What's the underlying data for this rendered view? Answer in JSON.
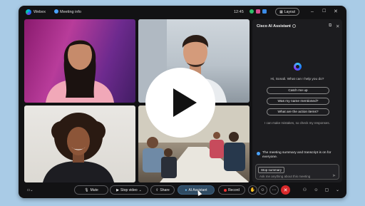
{
  "app": {
    "name": "Webex",
    "meeting_info_label": "Meeting info",
    "time": "12:45",
    "layout_label": "Layout"
  },
  "ai_panel": {
    "title": "Cisco AI Assistant",
    "greeting": "Hi, Sonali. What can I help you do?",
    "suggestions": [
      "Catch me up",
      "Was my name mentioned?",
      "What are the action items?"
    ],
    "disclaimer": "I can make mistakes, so check my responses.",
    "notice": "The meeting summary and transcript is on for everyone.",
    "stop_summary_label": "Stop summary",
    "input_placeholder": "Ask me anything about this meeting"
  },
  "toolbar": {
    "mute": "Mute",
    "stop_video": "Stop video",
    "share": "Share",
    "ai_assistant": "AI Assistant",
    "record": "Record"
  },
  "colors": {
    "window_bg": "#121214",
    "page_bg": "#a9cbe6",
    "accent": "#4aa3ff",
    "end_call": "#d9292b"
  },
  "icons": [
    "webex-logo-icon",
    "info-icon",
    "layout-icon",
    "minimize-icon",
    "maximize-icon",
    "close-icon",
    "pop-out-icon",
    "microphone-icon",
    "camera-icon",
    "share-icon",
    "ai-assistant-icon",
    "record-icon",
    "raise-hand-icon",
    "reactions-icon",
    "more-icon",
    "end-call-icon",
    "participants-icon",
    "chat-icon",
    "send-icon",
    "play-icon"
  ]
}
